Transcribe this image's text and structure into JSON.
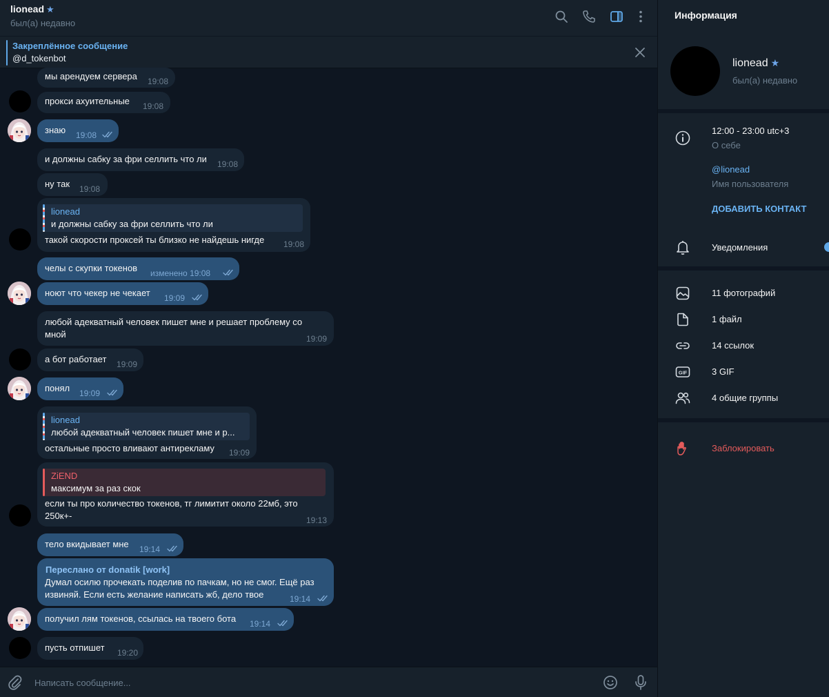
{
  "header": {
    "name": "lionead",
    "status": "был(а) недавно"
  },
  "pinned": {
    "title": "Закреплённое сообщение",
    "text": "@d_tokenbot"
  },
  "messages": [
    {
      "text": "мы арендуем сервера",
      "time": "19:08"
    },
    {
      "text": "прокси ахуительные",
      "time": "19:08"
    },
    {
      "text": "знаю",
      "time": "19:08"
    },
    {
      "text": "и должны сабку за фри селлить что ли",
      "time": "19:08"
    },
    {
      "text": "ну так",
      "time": "19:08"
    },
    {
      "reply_name": "lionead",
      "reply_text": "и должны сабку за фри селлить что ли",
      "text": "такой скорости проксей ты близко не найдешь нигде",
      "time": "19:08"
    },
    {
      "text": "челы с скупки токенов",
      "time": "изменено 19:08"
    },
    {
      "text": "ноют что чекер не чекает",
      "time": "19:09"
    },
    {
      "text_line1": "любой адекватный человек пишет мне и решает проблему со",
      "text_line2": "мной",
      "time": "19:09"
    },
    {
      "text": "а бот работает",
      "time": "19:09"
    },
    {
      "text": "понял",
      "time": "19:09"
    },
    {
      "reply_name": "lionead",
      "reply_text": "любой адекватный человек пишет мне и р...",
      "text": "остальные просто вливают антирекламу",
      "time": "19:09"
    },
    {
      "reply_name": "ZiEND",
      "reply_text": "максимум за раз скок",
      "text_line1": "если ты про количество токенов, тг лимитит около 22мб, это",
      "text_line2": "250к+-",
      "time": "19:13"
    },
    {
      "text": "тело вкидывает мне",
      "time": "19:14"
    },
    {
      "fwd": "Переслано от donatik [work]",
      "text_line1": "Думал осилю прочекать поделив по пачкам, но не смог. Ещё раз",
      "text_line2": "извиняй. Если есть желание написать жб, дело твое",
      "time": "19:14"
    },
    {
      "text": "получил лям токенов, ссылась на твоего бота",
      "time": "19:14"
    },
    {
      "text": "пусть отпишет",
      "time": "19:20"
    }
  ],
  "composer": {
    "placeholder": "Написать сообщение..."
  },
  "info": {
    "title": "Информация",
    "name": "lionead",
    "status": "был(а) недавно",
    "bio": "12:00 - 23:00 utc+3",
    "bio_label": "О себе",
    "username": "@lionead",
    "username_label": "Имя пользователя",
    "add_contact": "ДОБАВИТЬ КОНТАКТ",
    "notifications": "Уведомления",
    "media": [
      {
        "icon": "photo-icon",
        "label": "11 фотографий"
      },
      {
        "icon": "file-icon",
        "label": "1 файл"
      },
      {
        "icon": "link-icon",
        "label": "14 ссылок"
      },
      {
        "icon": "gif-icon",
        "label": "3 GIF"
      },
      {
        "icon": "groups-icon",
        "label": "4 общие группы"
      }
    ],
    "block": "Заблокировать"
  },
  "colors": {
    "chat_bg": "#0e1621",
    "panel_bg": "#17212b",
    "bubble_in": "#182533",
    "bubble_out": "#2b5278",
    "accent": "#6ab3f3",
    "danger": "#e45b5b"
  }
}
